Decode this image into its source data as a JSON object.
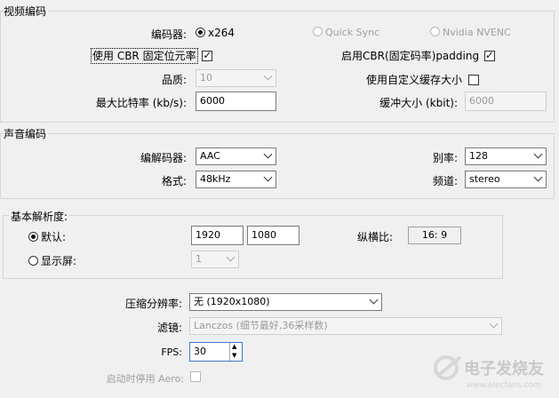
{
  "video": {
    "section_title": "视频编码",
    "encoder_label": "编码器:",
    "encoder_options": [
      "x264",
      "Quick Sync",
      "Nvidia NVENC"
    ],
    "use_cbr_label": "使用 CBR 固定位元率",
    "enable_cbr_padding_label": "启用CBR(固定码率)padding",
    "quality_label": "品质:",
    "quality_value": "10",
    "custom_buffer_label": "使用自定义缓存大小",
    "max_bitrate_label": "最大比特率 (kb/s):",
    "max_bitrate_value": "6000",
    "buffer_size_label": "缓冲大小 (kbit):",
    "buffer_size_value": "6000"
  },
  "audio": {
    "section_title": "声音编码",
    "codec_label": "编解码器:",
    "codec_value": "AAC",
    "bitrate_label": "别率:",
    "bitrate_value": "128",
    "format_label": "格式:",
    "format_value": "48kHz",
    "channel_label": "频道:",
    "channel_value": "stereo"
  },
  "resolution": {
    "section_title": "基本解析度:",
    "default_label": "默认:",
    "width_value": "1920",
    "height_value": "1080",
    "aspect_label": "纵横比:",
    "aspect_value": "16:  9",
    "monitor_label": "显示屏:",
    "monitor_value": "1",
    "downscale_label": "压缩分辨率:",
    "downscale_value": "无  (1920x1080)",
    "filter_label": "滤镜:",
    "filter_value": "Lanczos (细节最好,36采样数)",
    "fps_label": "FPS:",
    "fps_value": "30",
    "disable_aero_label": "启动时停用 Aero:"
  },
  "watermark": "电子发烧友",
  "watermark_url": "www.elecfans.com"
}
